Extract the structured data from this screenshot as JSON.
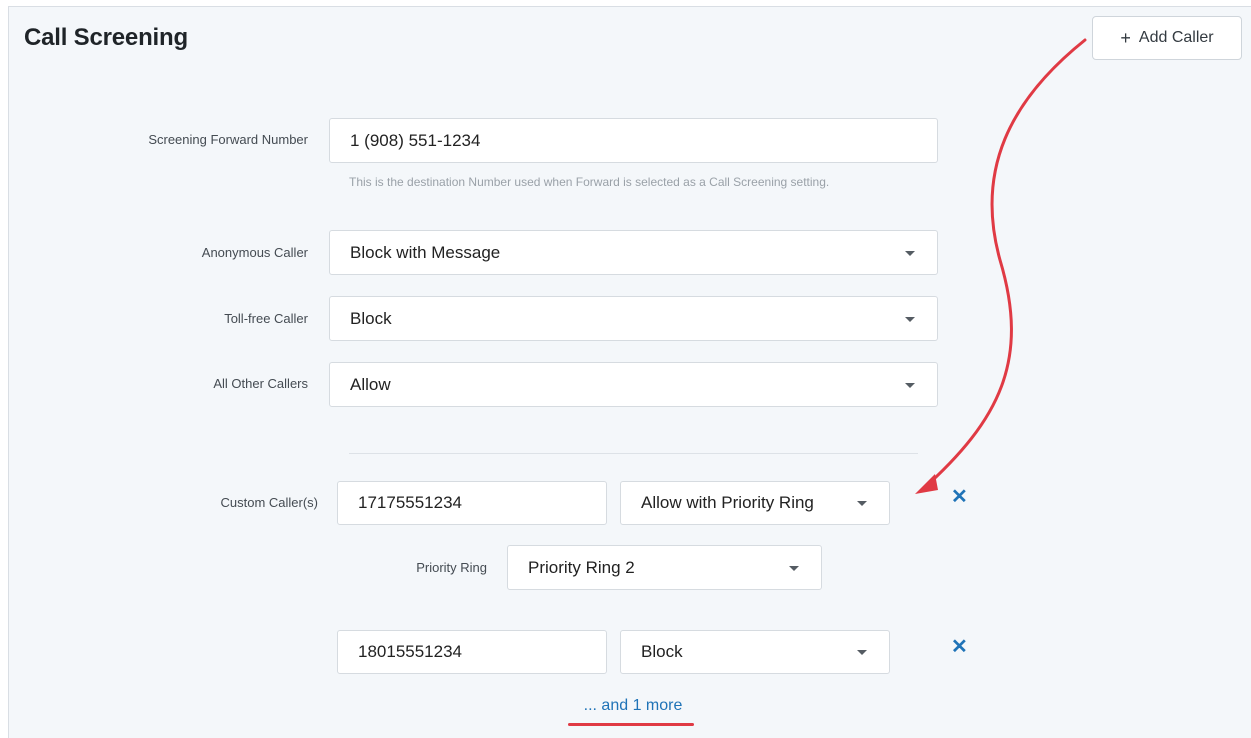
{
  "header": {
    "title": "Call Screening",
    "add_button_icon": "plus-icon",
    "add_button_label": "Add Caller"
  },
  "form": {
    "forward_number": {
      "label": "Screening Forward Number",
      "value": "1 (908) 551-1234",
      "hint": "This is the destination Number used when Forward is selected as a Call Screening setting."
    },
    "anonymous_caller": {
      "label": "Anonymous Caller",
      "value": "Block with Message"
    },
    "toll_free_caller": {
      "label": "Toll-free Caller",
      "value": "Block"
    },
    "all_other_callers": {
      "label": "All Other Callers",
      "value": "Allow"
    }
  },
  "custom_callers": {
    "label": "Custom Caller(s)",
    "items": [
      {
        "number": "17175551234",
        "action": "Allow with Priority Ring",
        "priority_label": "Priority Ring",
        "priority_value": "Priority Ring 2"
      },
      {
        "number": "18015551234",
        "action": "Block"
      }
    ],
    "remove_icon": "close-icon",
    "more_link": "... and 1 more"
  },
  "colors": {
    "panel_bg": "#f4f7fa",
    "link": "#1f73b7",
    "annotation": "#e03a44"
  }
}
